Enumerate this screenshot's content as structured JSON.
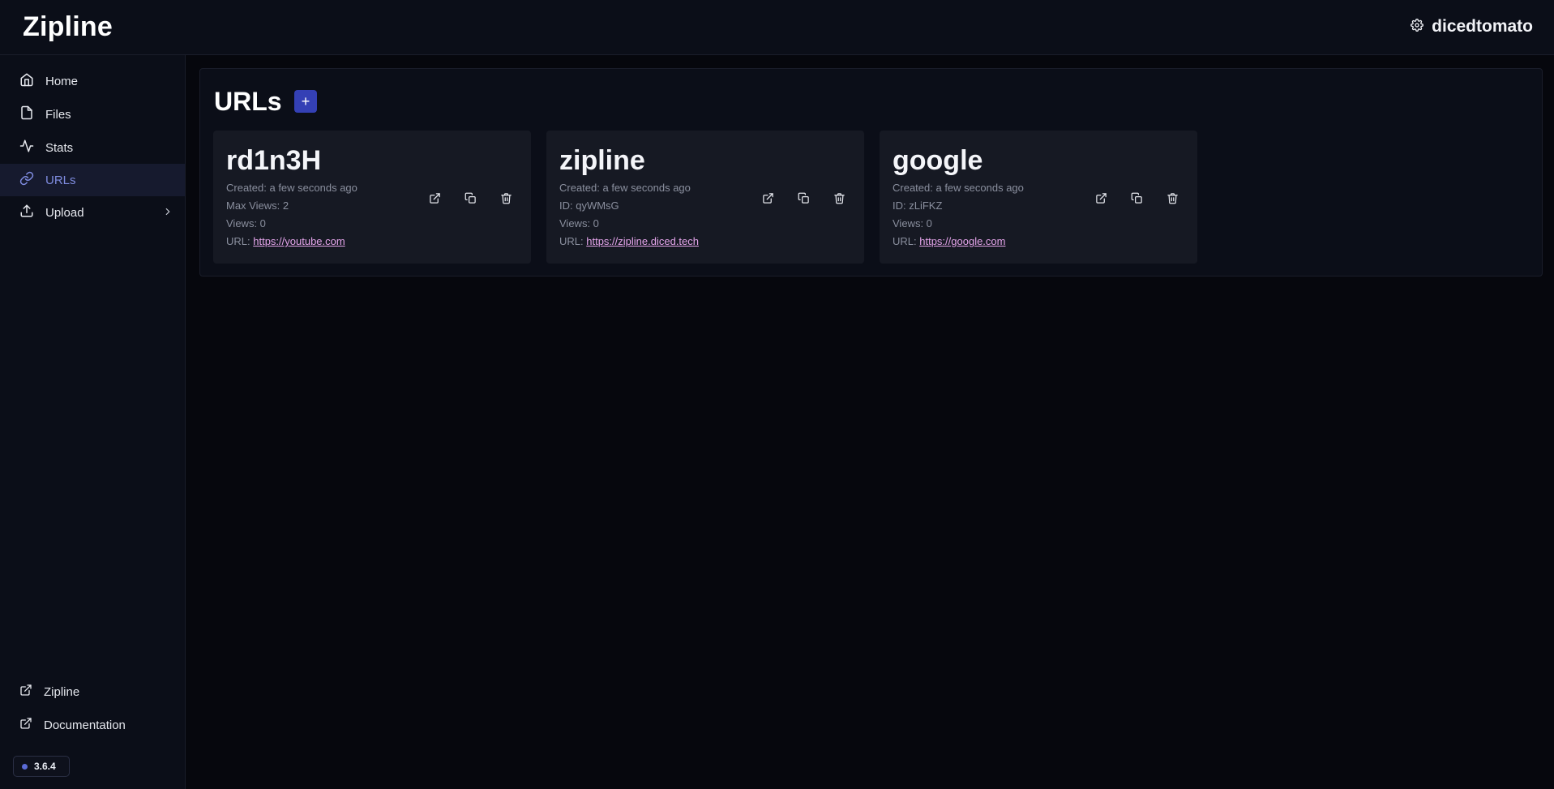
{
  "app": {
    "brand": "Zipline"
  },
  "header": {
    "username": "dicedtomato"
  },
  "sidebar": {
    "items": [
      {
        "label": "Home",
        "icon": "home-icon"
      },
      {
        "label": "Files",
        "icon": "file-icon"
      },
      {
        "label": "Stats",
        "icon": "activity-icon"
      },
      {
        "label": "URLs",
        "icon": "link-icon",
        "active": true
      },
      {
        "label": "Upload",
        "icon": "upload-icon"
      }
    ],
    "footer_links": [
      {
        "label": "Zipline",
        "icon": "external-link-icon"
      },
      {
        "label": "Documentation",
        "icon": "external-link-icon"
      }
    ],
    "version": "3.6.4"
  },
  "main": {
    "title": "URLs",
    "add_label": "+",
    "cards": [
      {
        "name": "rd1n3H",
        "created": "Created: a few seconds ago",
        "line2": "Max Views: 2",
        "views": "Views: 0",
        "url_label": "URL:",
        "url": "https://youtube.com"
      },
      {
        "name": "zipline",
        "created": "Created: a few seconds ago",
        "line2": "ID: qyWMsG",
        "views": "Views: 0",
        "url_label": "URL:",
        "url": "https://zipline.diced.tech"
      },
      {
        "name": "google",
        "created": "Created: a few seconds ago",
        "line2": "ID: zLiFKZ",
        "views": "Views: 0",
        "url_label": "URL:",
        "url": "https://google.com"
      }
    ]
  },
  "colors": {
    "accent": "#3440b5",
    "link": "#e4a4ea",
    "active_nav": "#7f8ce0"
  }
}
